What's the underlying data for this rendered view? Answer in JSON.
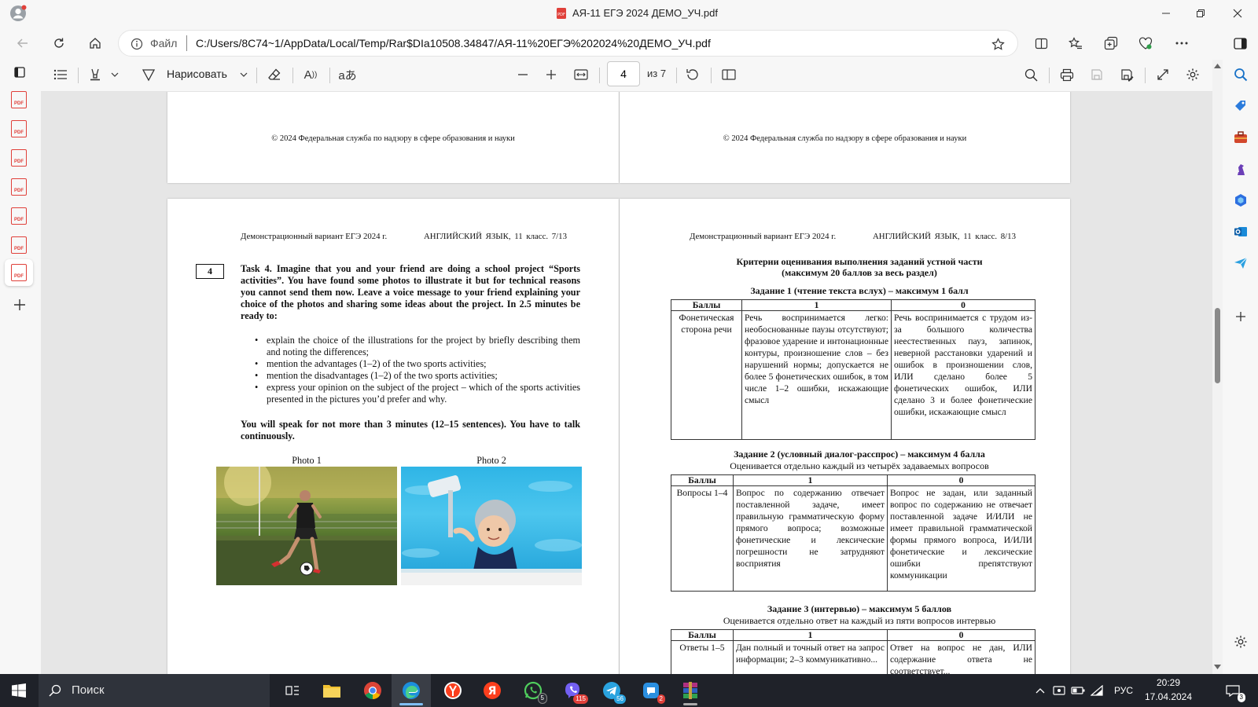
{
  "window": {
    "title": "АЯ-11 ЕГЭ 2024 ДЕМО_УЧ.pdf",
    "file_label": "Файл",
    "url": "C:/Users/8C74~1/AppData/Local/Temp/Rar$DIa10508.34847/АЯ-11%20ЕГЭ%202024%20ДЕМО_УЧ.pdf"
  },
  "toolbar": {
    "draw_label": "Нарисовать",
    "page_number": "4",
    "page_total": "из 7"
  },
  "document": {
    "copyright": "© 2024 Федеральная служба по надзору в сфере образования и науки",
    "header_left_7": "Демонстрационный вариант ЕГЭ 2024 г.",
    "header_right_7": "АНГЛИЙСКИЙ ЯЗЫК, 11 класс. 7/13",
    "header_left_8": "Демонстрационный вариант ЕГЭ 2024 г.",
    "header_right_8": "АНГЛИЙСКИЙ ЯЗЫК, 11 класс. 8/13",
    "task_number": "4",
    "task_intro": "Task 4. Imagine that you and your friend are doing a school project “Sports activities”. You have found some photos to illustrate it but for technical reasons you cannot send them now. Leave a voice message to your friend explaining your choice of the photos and sharing some ideas about the project. In 2.5 minutes be ready to:",
    "bullets": [
      "explain the choice of the illustrations for the project by briefly describing them and noting the differences;",
      "mention the advantages (1–2) of the two sports activities;",
      "mention the disadvantages (1–2) of the two sports activities;",
      "express your opinion on the subject of the project – which of the sports activities presented in the pictures you’d prefer and why."
    ],
    "closing": "You will speak for not more than 3 minutes (12–15 sentences). You have to talk continuously.",
    "photo1_caption": "Photo 1",
    "photo2_caption": "Photo 2",
    "criteria_title_1": "Критерии оценивания выполнения заданий устной части",
    "criteria_title_2": "(максимум 20 баллов за весь раздел)",
    "task1_title": "Задание 1 (чтение текста вслух) – максимум 1 балл",
    "task2_title": "Задание 2 (условный диалог-расспрос) – максимум 4 балла",
    "task2_subtitle": "Оценивается отдельно каждый из четырёх задаваемых вопросов",
    "task3_title": "Задание 3 (интервью) – максимум 5 баллов",
    "task3_subtitle": "Оценивается отдельно ответ на каждый из пяти вопросов интервью",
    "col_points": "Баллы",
    "col_1": "1",
    "col_0": "0",
    "t1_row_label": "Фонетическая сторона речи",
    "t1_col1": "Речь воспринимается легко: необоснованные паузы отсутствуют; фразовое ударение и интонационные контуры, произношение слов – без нарушений нормы; допускается не более 5 фонетических ошибок, в том числе 1–2 ошибки, искажающие смысл",
    "t1_col0": "Речь воспринимается с трудом из-за большого количества неестественных пауз, запинок, неверной расстановки ударений и ошибок в произношении слов, ИЛИ сделано более 5 фонетических ошибок, ИЛИ сделано 3 и более фонетические ошибки, искажающие смысл",
    "t2_row_label": "Вопросы 1–4",
    "t2_col1": "Вопрос по содержанию отвечает поставленной задаче, имеет правильную грамматическую форму прямого вопроса; возможные фонетические и лексические погрешности не затрудняют восприятия",
    "t2_col0": "Вопрос не задан, или заданный вопрос по содержанию не отвечает поставленной задаче И/ИЛИ не имеет правильной грамматической формы прямого вопроса, И/ИЛИ фонетические и лексические ошибки препятствуют коммуникации",
    "t3_row_label": "Ответы 1–5",
    "t3_col1": "Дан полный и точный ответ на запрос информации; 2–3 коммуникативно...",
    "t3_col0": "Ответ на вопрос не дан, ИЛИ содержание ответа не соответствует..."
  },
  "taskbar": {
    "search_placeholder": "Поиск",
    "language": "РУС",
    "time": "20:29",
    "date": "17.04.2024",
    "notification_count": "3",
    "badges": {
      "whatsapp": "5",
      "viber": "115",
      "telegram": "56",
      "other": "2"
    }
  },
  "colors": {
    "accent_red": "#e0403a",
    "taskbar_bg": "#1f2229",
    "chrome_bg": "#f7f7f7"
  }
}
